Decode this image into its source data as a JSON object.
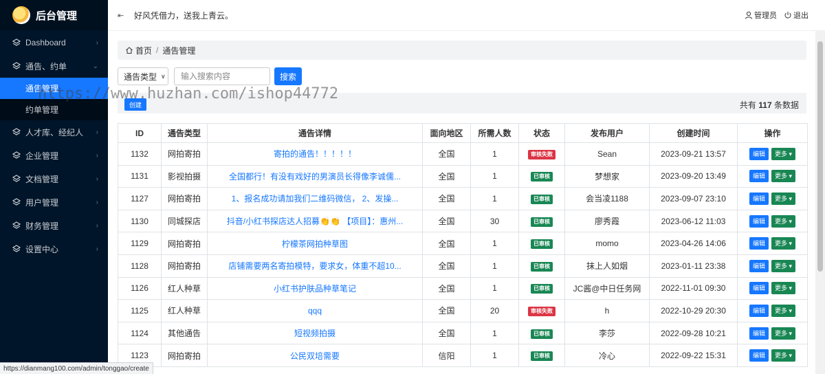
{
  "sidebar": {
    "title": "后台管理",
    "items": [
      {
        "label": "Dashboard",
        "icon": "layers-icon"
      },
      {
        "label": "通告、约单",
        "icon": "layers-icon",
        "expanded": true,
        "children": [
          {
            "label": "通告管理",
            "active": true
          },
          {
            "label": "约单管理"
          }
        ]
      },
      {
        "label": "人才库、经纪人",
        "icon": "layers-icon"
      },
      {
        "label": "企业管理",
        "icon": "layers-icon"
      },
      {
        "label": "文档管理",
        "icon": "layers-icon"
      },
      {
        "label": "用户管理",
        "icon": "layers-icon"
      },
      {
        "label": "财务管理",
        "icon": "layers-icon"
      },
      {
        "label": "设置中心",
        "icon": "layers-icon"
      }
    ]
  },
  "header": {
    "motto": "好风凭借力，送我上青云。",
    "admin_label": "管理员",
    "logout_label": "退出"
  },
  "breadcrumb": {
    "home": "首页",
    "current": "通告管理"
  },
  "filters": {
    "type_select": "通告类型",
    "search_placeholder": "输入搜索内容",
    "search_label": "搜索"
  },
  "toolbar": {
    "create_label": "创建",
    "total_prefix": "共有",
    "total_count": "117",
    "total_suffix": "条数据"
  },
  "table": {
    "columns": [
      "ID",
      "通告类型",
      "通告详情",
      "面向地区",
      "所需人数",
      "状态",
      "发布用户",
      "创建时间",
      "操作"
    ],
    "edit_label": "编辑",
    "more_label": "更多",
    "rows": [
      {
        "id": "1132",
        "type": "网拍寄拍",
        "detail": "寄拍的通告！！！！！",
        "region": "全国",
        "count": "1",
        "status": "审核失败",
        "status_kind": "fail",
        "user": "Sean",
        "created": "2023-09-21 13:57"
      },
      {
        "id": "1131",
        "type": "影视拍摄",
        "detail": "全国都行！有没有戏好的男演员长得像李诚儒...",
        "region": "全国",
        "count": "1",
        "status": "已审核",
        "status_kind": "ok",
        "user": "梦想家",
        "created": "2023-09-20 13:49"
      },
      {
        "id": "1127",
        "type": "网拍寄拍",
        "detail": "1、报名成功请加我们二维码微信， 2、发操...",
        "region": "全国",
        "count": "1",
        "status": "已审核",
        "status_kind": "ok",
        "user": "会当凌1188",
        "created": "2023-09-07 23:10"
      },
      {
        "id": "1130",
        "type": "同城探店",
        "detail": "抖音/小红书探店达人招募👏👏 【项目】：惠州...",
        "region": "全国",
        "count": "30",
        "status": "已审核",
        "status_kind": "ok",
        "user": "廖秀霞",
        "created": "2023-06-12 11:03"
      },
      {
        "id": "1129",
        "type": "网拍寄拍",
        "detail": "柠檬茶网拍种草图",
        "region": "全国",
        "count": "1",
        "status": "已审核",
        "status_kind": "ok",
        "user": "momo",
        "created": "2023-04-26 14:06"
      },
      {
        "id": "1128",
        "type": "网拍寄拍",
        "detail": "店铺需要两名寄拍模特，要求女，体重不超10...",
        "region": "全国",
        "count": "1",
        "status": "已审核",
        "status_kind": "ok",
        "user": "抹上人如烟",
        "created": "2023-01-11 23:38"
      },
      {
        "id": "1126",
        "type": "红人种草",
        "detail": "小红书护肤品种草笔记",
        "region": "全国",
        "count": "1",
        "status": "已审核",
        "status_kind": "ok",
        "user": "JC酱@中日任务网",
        "created": "2022-11-01 09:30"
      },
      {
        "id": "1125",
        "type": "红人种草",
        "detail": "qqq",
        "region": "全国",
        "count": "20",
        "status": "审核失败",
        "status_kind": "fail",
        "user": "h",
        "created": "2022-10-29 20:30"
      },
      {
        "id": "1124",
        "type": "其他通告",
        "detail": "短视频拍摄",
        "region": "全国",
        "count": "1",
        "status": "已审核",
        "status_kind": "ok",
        "user": "李莎",
        "created": "2022-09-28 10:21"
      },
      {
        "id": "1123",
        "type": "网拍寄拍",
        "detail": "公民双培需要",
        "region": "信阳",
        "count": "1",
        "status": "已审核",
        "status_kind": "ok",
        "user": "冷心",
        "created": "2022-09-22 15:31"
      }
    ]
  },
  "watermark": "https://www.huzhan.com/ishop44772",
  "status_url": "https://dianmang100.com/admin/tonggao/create",
  "colors": {
    "sidebar_bg": "#001529",
    "primary": "#1677ff",
    "success": "#198754",
    "danger": "#dc3545"
  }
}
